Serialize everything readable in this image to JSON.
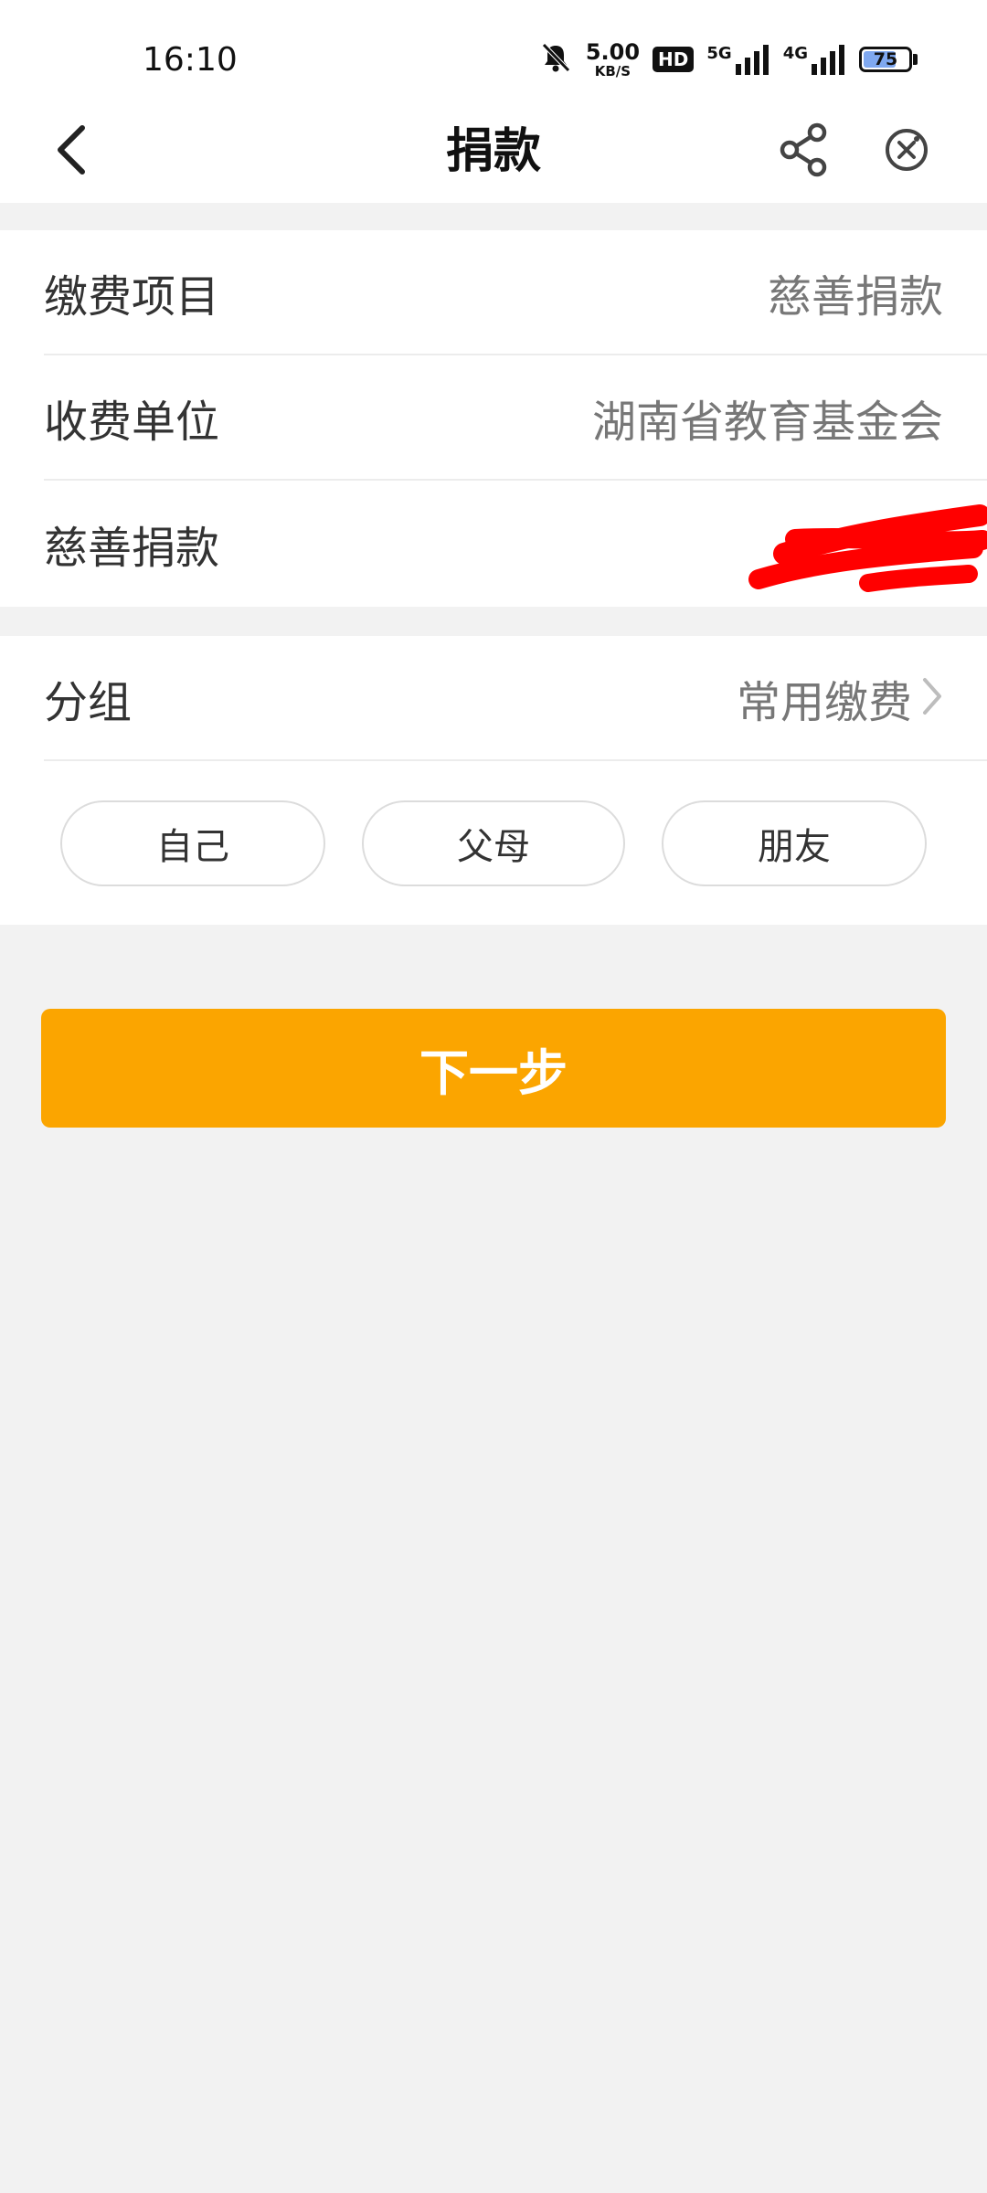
{
  "status_bar": {
    "time": "16:10",
    "net_speed_value": "5.00",
    "net_speed_unit": "KB/S",
    "hd_badge": "HD",
    "signal_5g": "5G",
    "signal_4g": "4G",
    "battery_level": "75",
    "battery_percent": 75
  },
  "nav": {
    "title": "捐款",
    "back_icon": "chevron-left-icon",
    "share_icon": "share-icon",
    "close_icon": "close-circle-icon"
  },
  "details": {
    "payment_item_label": "缴费项目",
    "payment_item_value": "慈善捐款",
    "payee_label": "收费单位",
    "payee_value": "湖南省教育基金会",
    "donation_label": "慈善捐款"
  },
  "group": {
    "label": "分组",
    "value": "常用缴费",
    "chips": [
      "自己",
      "父母",
      "朋友"
    ]
  },
  "next_button": "下一步",
  "colors": {
    "accent": "#fba500",
    "redaction": "#ff0000",
    "background": "#f2f2f2"
  }
}
